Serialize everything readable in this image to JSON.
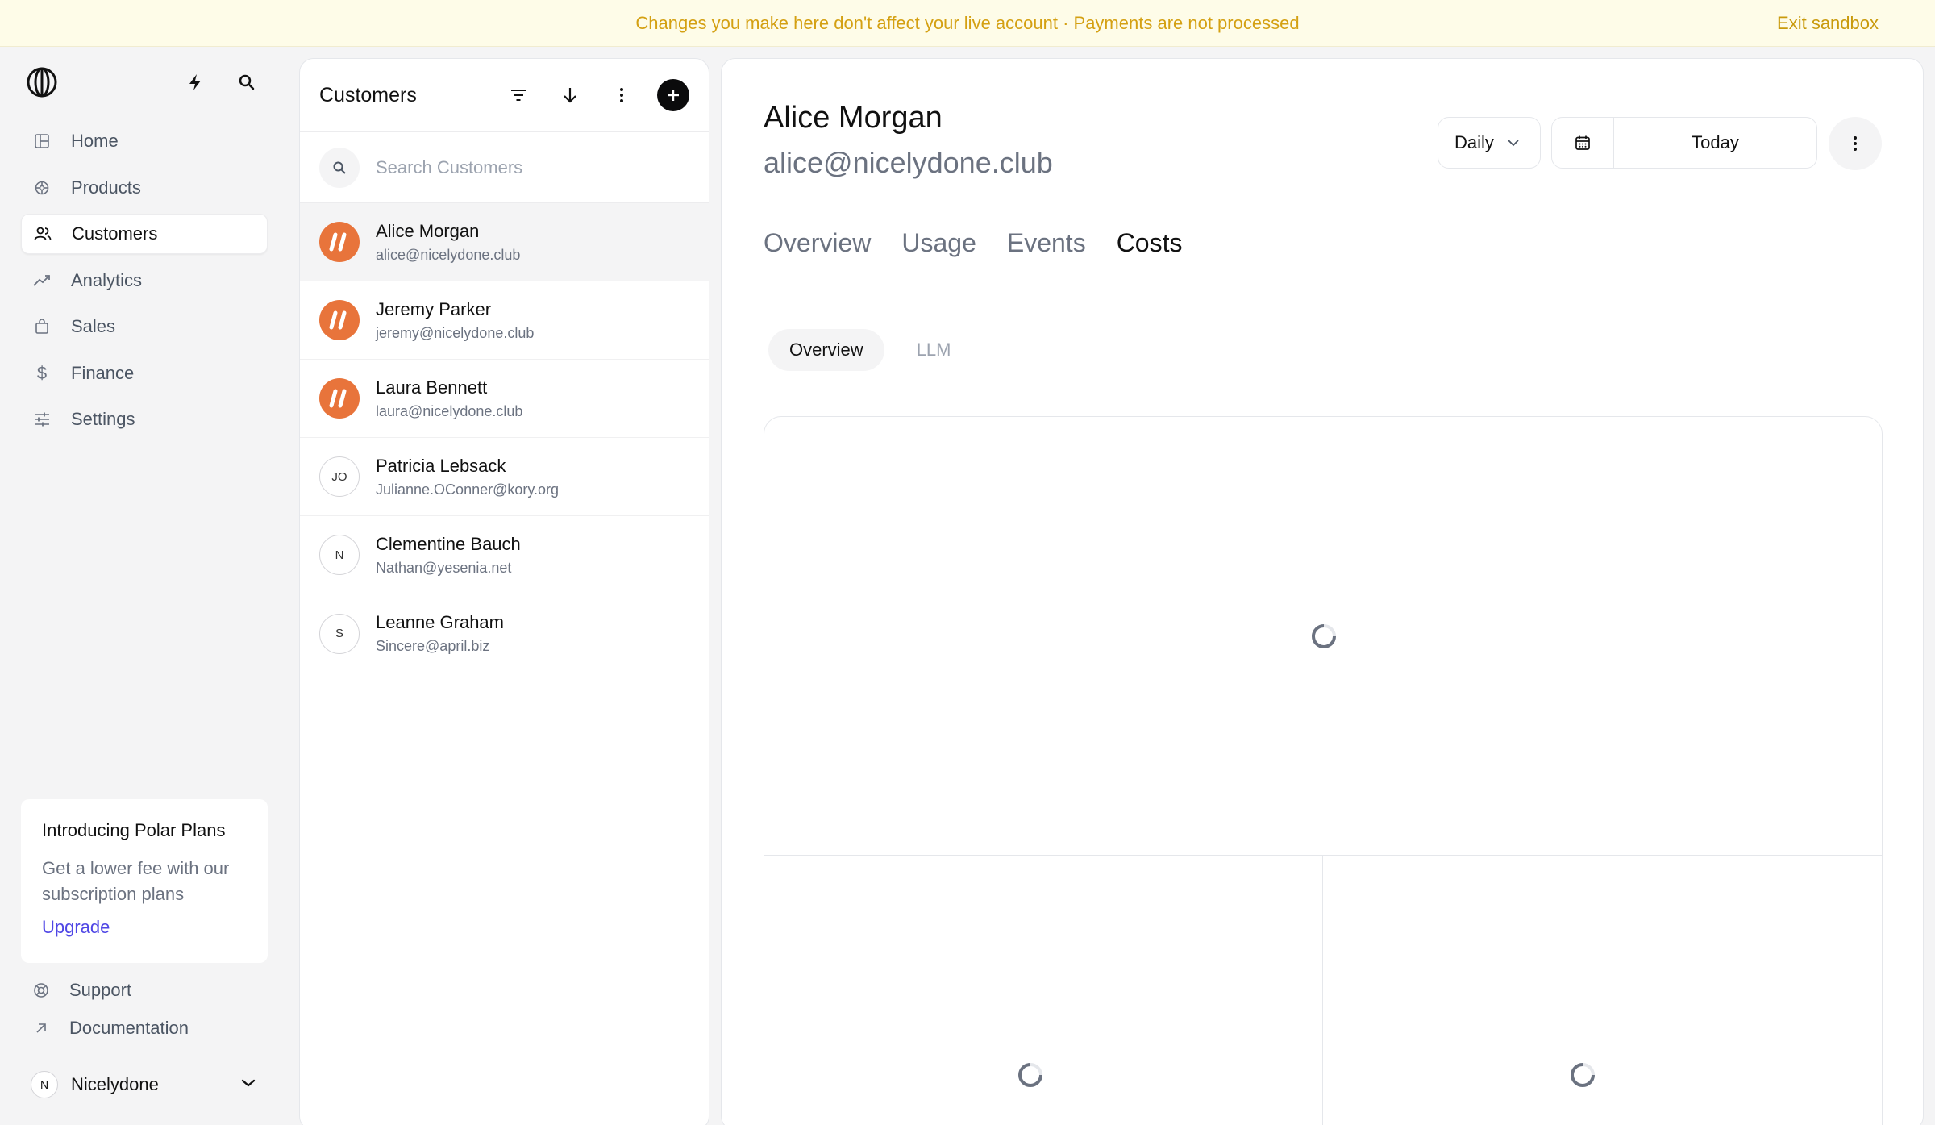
{
  "banner": {
    "message": "Changes you make here don't affect your live account · Payments are not processed",
    "exit_label": "Exit sandbox",
    "color": "#d4a012"
  },
  "sidebar": {
    "items": [
      {
        "label": "Home",
        "icon": "home-icon"
      },
      {
        "label": "Products",
        "icon": "products-icon"
      },
      {
        "label": "Customers",
        "icon": "users-icon",
        "active": true
      },
      {
        "label": "Analytics",
        "icon": "trend-icon"
      },
      {
        "label": "Sales",
        "icon": "bag-icon"
      },
      {
        "label": "Finance",
        "icon": "dollar-icon"
      },
      {
        "label": "Settings",
        "icon": "sliders-icon"
      }
    ],
    "promo": {
      "title": "Introducing Polar Plans",
      "text": "Get a lower fee with our subscription plans",
      "link": "Upgrade"
    },
    "support": "Support",
    "documentation": "Documentation",
    "org": {
      "initial": "N",
      "name": "Nicelydone"
    }
  },
  "customers_panel": {
    "title": "Customers",
    "search_placeholder": "Search Customers",
    "customers": [
      {
        "name": "Alice Morgan",
        "email": "alice@nicelydone.club",
        "avatar": "brand",
        "active": true
      },
      {
        "name": "Jeremy Parker",
        "email": "jeremy@nicelydone.club",
        "avatar": "brand"
      },
      {
        "name": "Laura Bennett",
        "email": "laura@nicelydone.club",
        "avatar": "brand"
      },
      {
        "name": "Patricia Lebsack",
        "email": "Julianne.OConner@kory.org",
        "avatar": "JO"
      },
      {
        "name": "Clementine Bauch",
        "email": "Nathan@yesenia.net",
        "avatar": "N"
      },
      {
        "name": "Leanne Graham",
        "email": "Sincere@april.biz",
        "avatar": "S"
      }
    ]
  },
  "detail": {
    "name": "Alice Morgan",
    "email": "alice@nicelydone.club",
    "interval": "Daily",
    "date_range": "Today",
    "tabs": [
      "Overview",
      "Usage",
      "Events",
      "Costs"
    ],
    "active_tab": "Costs",
    "subtabs": [
      "Overview",
      "LLM"
    ],
    "active_subtab": "Overview"
  }
}
